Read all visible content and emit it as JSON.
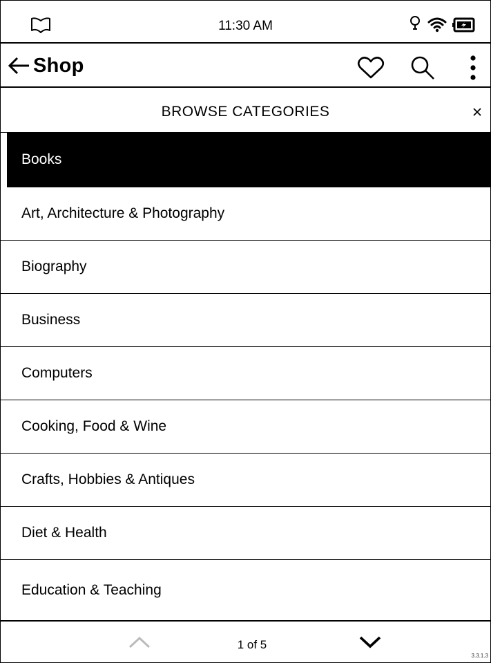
{
  "status_bar": {
    "time": "11:30 AM",
    "icons": [
      "book-icon",
      "light-icon",
      "wifi-icon",
      "battery-icon"
    ]
  },
  "header": {
    "title": "Shop",
    "icons": [
      "back-arrow-icon",
      "heart-icon",
      "search-icon",
      "more-vertical-icon"
    ]
  },
  "browse": {
    "title": "BROWSE CATEGORIES",
    "close_label": "×"
  },
  "categories": {
    "section": "Books",
    "items": [
      "Art, Architecture & Photography",
      "Biography",
      "Business",
      "Computers",
      "Cooking, Food & Wine",
      "Crafts, Hobbies & Antiques",
      "Diet & Health",
      "Education & Teaching"
    ]
  },
  "footer": {
    "page": "1 of 5",
    "version": "3.3.1.3"
  },
  "colors": {
    "ink": "#000000",
    "paper": "#ffffff",
    "disabled": "#bbbbbb"
  }
}
